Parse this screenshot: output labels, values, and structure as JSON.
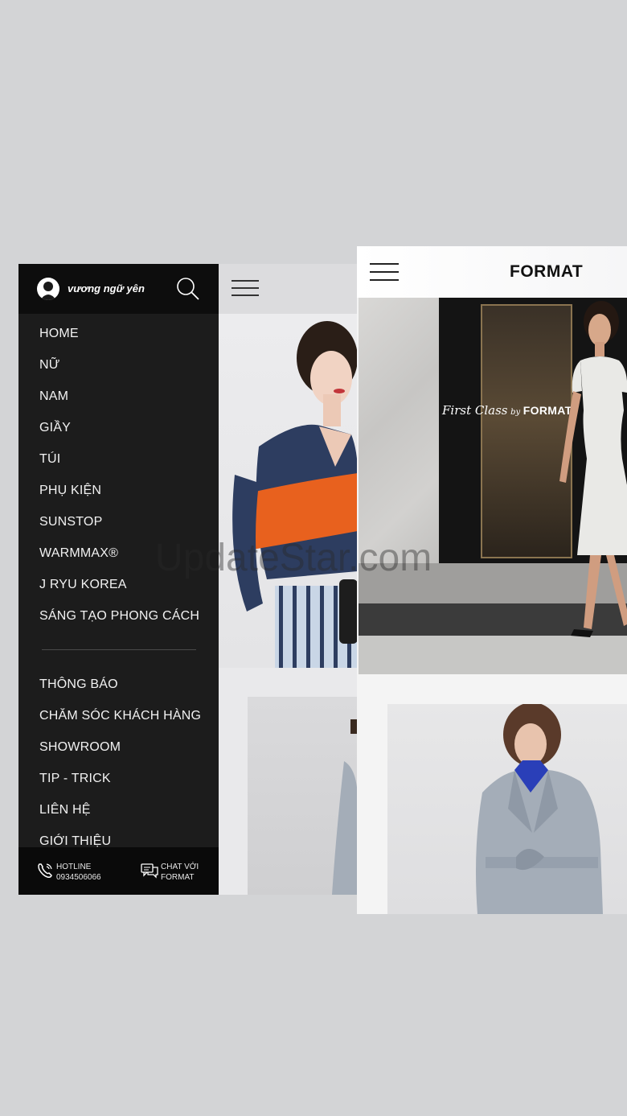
{
  "left_screen": {
    "user": {
      "name": "vương ngữ yên",
      "avatar_icon": "user-silhouette-icon"
    },
    "search_icon": "search-icon",
    "menu_icon": "hamburger-icon",
    "primary_menu": [
      {
        "label": "HOME"
      },
      {
        "label": "NỮ"
      },
      {
        "label": "NAM"
      },
      {
        "label": "GIẦY"
      },
      {
        "label": "TÚI"
      },
      {
        "label": "PHỤ KIỆN"
      },
      {
        "label": "SUNSTOP"
      },
      {
        "label": "WARMMAX®"
      },
      {
        "label": "J RYU KOREA"
      },
      {
        "label": "SÁNG TẠO PHONG CÁCH"
      }
    ],
    "secondary_menu": [
      {
        "label": "THÔNG BÁO"
      },
      {
        "label": "CHĂM SÓC KHÁCH HÀNG"
      },
      {
        "label": "SHOWROOM"
      },
      {
        "label": "TIP - TRICK"
      },
      {
        "label": "LIÊN HỆ"
      },
      {
        "label": "GIỚI THIỆU"
      }
    ],
    "footer": {
      "hotline": {
        "label": "HOTLINE",
        "number": "0934506066",
        "icon": "phone-icon"
      },
      "chat": {
        "line1": "CHAT VỚI",
        "line2": "FORMAT",
        "icon": "chat-icon"
      }
    }
  },
  "right_screen": {
    "brand": "FORMAT",
    "menu_icon": "hamburger-icon",
    "hero": {
      "tagline_script": "First Class",
      "tagline_by": "by",
      "tagline_brand": "FORMAT"
    }
  },
  "watermark": "UpdateStar.com",
  "colors": {
    "background": "#d3d4d6",
    "menu_panel": "#1c1c1c",
    "menu_header": "#0d0d0d",
    "menu_text": "#f2f2f2",
    "shirt_navy": "#2d3d60",
    "shirt_orange": "#e8611e",
    "coat_grey": "#a4adb8",
    "collar_blue": "#2a3fb8"
  }
}
